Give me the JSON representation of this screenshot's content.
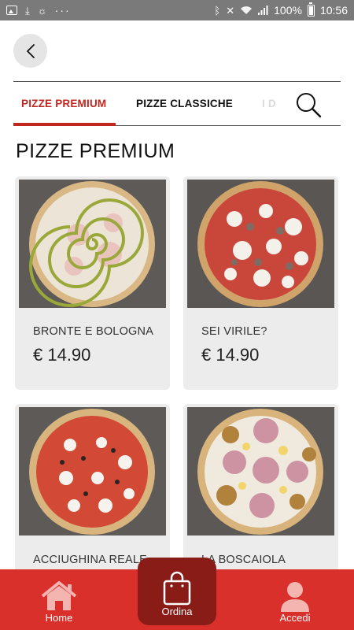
{
  "status_bar": {
    "battery": "100%",
    "time": "10:56",
    "left_icons": [
      "image-icon",
      "download-icon",
      "sync-icon",
      "more-dots-icon"
    ],
    "right_icons": [
      "bluetooth-icon",
      "mute-icon",
      "wifi-icon",
      "signal-icon",
      "battery-icon"
    ]
  },
  "header": {
    "back_icon": "chevron-left-icon"
  },
  "tabs": [
    {
      "label": "PIZZE PREMIUM",
      "active": true
    },
    {
      "label": "PIZZE CLASSICHE",
      "active": false
    },
    {
      "label": "I D",
      "active": false
    }
  ],
  "search_icon": "search-icon",
  "section_title": "PIZZE PREMIUM",
  "products": [
    {
      "name": "BRONTE E BOLOGNA",
      "price": "€ 14.90"
    },
    {
      "name": "SEI VIRILE?",
      "price": "€ 14.90"
    },
    {
      "name": "ACCIUGHINA REALE",
      "price": ""
    },
    {
      "name": "LA BOSCAIOLA",
      "price": ""
    }
  ],
  "bottom_nav": {
    "home": "Home",
    "ordina": "Ordina",
    "accedi": "Accedi"
  },
  "colors": {
    "accent": "#c0281f",
    "nav_bg": "#d9302b",
    "nav_center": "#8a1c18",
    "card_bg": "#ececec",
    "status_bar": "#7a7a7a"
  }
}
